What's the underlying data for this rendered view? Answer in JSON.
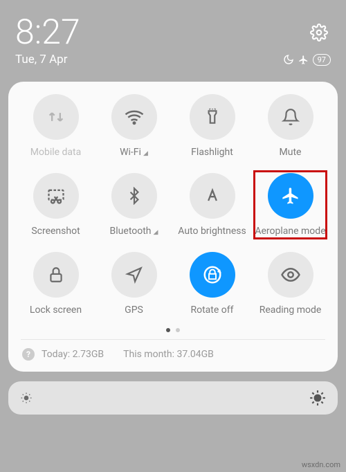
{
  "header": {
    "time": "8:27",
    "date": "Tue, 7 Apr",
    "battery": "97"
  },
  "tiles": {
    "mobile_data": "Mobile data",
    "wifi": "Wi-Fi",
    "flashlight": "Flashlight",
    "mute": "Mute",
    "screenshot": "Screenshot",
    "bluetooth": "Bluetooth",
    "auto_brightness": "Auto brightness",
    "aeroplane": "Aeroplane mode",
    "lock_screen": "Lock screen",
    "gps": "GPS",
    "rotate_off": "Rotate off",
    "reading_mode": "Reading mode"
  },
  "usage": {
    "today_label": "Today:",
    "today_value": "2.73GB",
    "month_label": "This month:",
    "month_value": "37.04GB"
  },
  "watermark": "wsxdn.com"
}
